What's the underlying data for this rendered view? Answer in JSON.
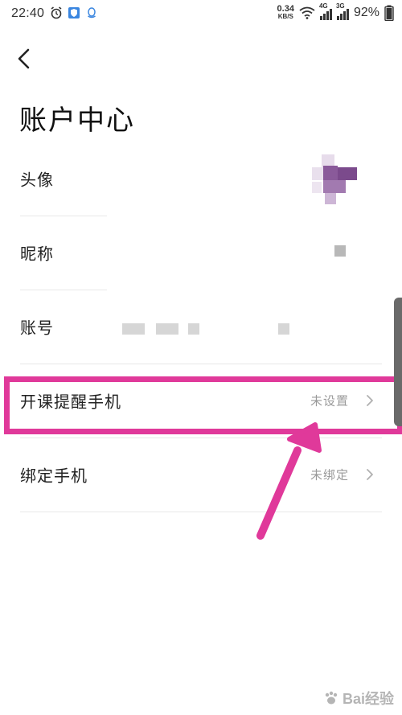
{
  "status_bar": {
    "time": "22:40",
    "net_speed_value": "0.34",
    "net_speed_unit": "KB/S",
    "sim1_tag": "4G",
    "sim2_tag": "3G",
    "battery_percent": "92%"
  },
  "header": {
    "title": "账户中心"
  },
  "rows": [
    {
      "label": "头像"
    },
    {
      "label": "昵称"
    },
    {
      "label": "账号"
    },
    {
      "label": "开课提醒手机",
      "value": "未设置"
    },
    {
      "label": "绑定手机",
      "value": "未绑定"
    }
  ],
  "watermark": {
    "text": "Bai经验"
  },
  "colors": {
    "highlight": "#e0399a",
    "avatar_purple": "#8a5a9a"
  }
}
